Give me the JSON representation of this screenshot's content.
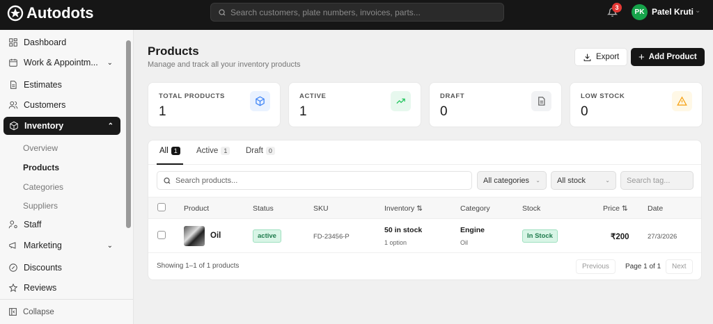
{
  "app": {
    "name": "Autodots",
    "search_placeholder": "Search customers, plate numbers, invoices, parts...",
    "notifications": "3",
    "user_initials": "PK",
    "user_name": "Patel Kruti"
  },
  "sidebar": {
    "items": [
      {
        "label": "Dashboard"
      },
      {
        "label": "Work & Appointm..."
      },
      {
        "label": "Estimates"
      },
      {
        "label": "Customers"
      },
      {
        "label": "Inventory"
      },
      {
        "label": "Staff"
      },
      {
        "label": "Marketing"
      },
      {
        "label": "Discounts"
      },
      {
        "label": "Reviews"
      }
    ],
    "inventory_sub": [
      "Overview",
      "Products",
      "Categories",
      "Suppliers"
    ],
    "collapse": "Collapse"
  },
  "page": {
    "title": "Products",
    "subtitle": "Manage and track all your inventory products",
    "export": "Export",
    "add": "Add Product"
  },
  "stats": [
    {
      "label": "TOTAL PRODUCTS",
      "value": "1"
    },
    {
      "label": "ACTIVE",
      "value": "1"
    },
    {
      "label": "DRAFT",
      "value": "0"
    },
    {
      "label": "LOW STOCK",
      "value": "0"
    }
  ],
  "tabs": [
    {
      "label": "All",
      "count": "1"
    },
    {
      "label": "Active",
      "count": "1"
    },
    {
      "label": "Draft",
      "count": "0"
    }
  ],
  "filters": {
    "search_placeholder": "Search products...",
    "category": "All categories",
    "stock": "All stock",
    "tag_placeholder": "Search tag..."
  },
  "columns": [
    "Product",
    "Status",
    "SKU",
    "Inventory ⇅",
    "Category",
    "Stock",
    "Price ⇅",
    "Date"
  ],
  "rows": [
    {
      "product": "Oil",
      "status": "active",
      "sku": "FD-23456-P",
      "inventory": "50 in stock",
      "options": "1 option",
      "category": "Engine",
      "subcategory": "Oil",
      "stock": "In Stock",
      "price": "₹200",
      "date": "27/3/2026"
    }
  ],
  "footer": {
    "showing": "Showing 1–1 of 1 products",
    "prev": "Previous",
    "page": "Page 1 of 1",
    "next": "Next"
  }
}
